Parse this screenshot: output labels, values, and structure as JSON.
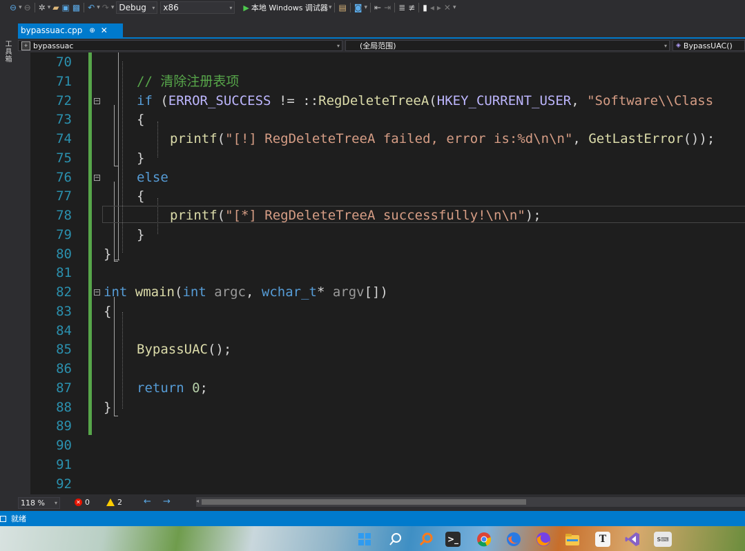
{
  "toolbar": {
    "config": "Debug",
    "platform": "x86",
    "debugger": "本地 Windows 调试器"
  },
  "side_panel": {
    "label": "工具箱"
  },
  "tab": {
    "filename": "bypassuac.cpp",
    "pin": "⊕",
    "close": "✕"
  },
  "navbar": {
    "project": "bypassuac",
    "scope": "(全局范围)",
    "member": "BypassUAC()"
  },
  "editor": {
    "lines": [
      {
        "n": "70",
        "tokens": []
      },
      {
        "n": "71",
        "tokens": [
          {
            "c": "cm",
            "t": "// 清除注册表项"
          }
        ]
      },
      {
        "n": "72",
        "tokens": [
          {
            "c": "kw",
            "t": "if"
          },
          {
            "c": "pn",
            "t": " ("
          },
          {
            "c": "mac",
            "t": "ERROR_SUCCESS"
          },
          {
            "c": "pn",
            "t": " != ::"
          },
          {
            "c": "fn",
            "t": "RegDeleteTreeA"
          },
          {
            "c": "pn",
            "t": "("
          },
          {
            "c": "mac",
            "t": "HKEY_CURRENT_USER"
          },
          {
            "c": "pn",
            "t": ", "
          },
          {
            "c": "str",
            "t": "\"Software\\\\Class"
          }
        ]
      },
      {
        "n": "73",
        "tokens": [
          {
            "c": "pn",
            "t": "{"
          }
        ]
      },
      {
        "n": "74",
        "tokens": [
          {
            "c": "fn",
            "t": "printf"
          },
          {
            "c": "pn",
            "t": "("
          },
          {
            "c": "str",
            "t": "\"[!] RegDeleteTreeA failed, error is:%d\\n\\n\""
          },
          {
            "c": "pn",
            "t": ", "
          },
          {
            "c": "fn",
            "t": "GetLastError"
          },
          {
            "c": "pn",
            "t": "());"
          }
        ]
      },
      {
        "n": "75",
        "tokens": [
          {
            "c": "pn",
            "t": "}"
          }
        ]
      },
      {
        "n": "76",
        "tokens": [
          {
            "c": "kw",
            "t": "else"
          }
        ]
      },
      {
        "n": "77",
        "tokens": [
          {
            "c": "pn",
            "t": "{"
          }
        ]
      },
      {
        "n": "78",
        "tokens": [
          {
            "c": "fn",
            "t": "printf"
          },
          {
            "c": "pn",
            "t": "("
          },
          {
            "c": "str",
            "t": "\"[*] RegDeleteTreeA successfully!\\n\\n\""
          },
          {
            "c": "pn",
            "t": ");"
          }
        ]
      },
      {
        "n": "79",
        "tokens": [
          {
            "c": "pn",
            "t": "}"
          }
        ]
      },
      {
        "n": "80",
        "tokens": [
          {
            "c": "pn",
            "t": "}"
          }
        ]
      },
      {
        "n": "81",
        "tokens": []
      },
      {
        "n": "82",
        "tokens": [
          {
            "c": "kw",
            "t": "int"
          },
          {
            "c": "pn",
            "t": " "
          },
          {
            "c": "fn",
            "t": "wmain"
          },
          {
            "c": "pn",
            "t": "("
          },
          {
            "c": "kw",
            "t": "int"
          },
          {
            "c": "pn",
            "t": " "
          },
          {
            "c": "prm",
            "t": "argc"
          },
          {
            "c": "pn",
            "t": ", "
          },
          {
            "c": "kw",
            "t": "wchar_t"
          },
          {
            "c": "pn",
            "t": "* "
          },
          {
            "c": "prm",
            "t": "argv"
          },
          {
            "c": "pn",
            "t": "[])"
          }
        ]
      },
      {
        "n": "83",
        "tokens": [
          {
            "c": "pn",
            "t": "{"
          }
        ]
      },
      {
        "n": "84",
        "tokens": []
      },
      {
        "n": "85",
        "tokens": [
          {
            "c": "fn",
            "t": "BypassUAC"
          },
          {
            "c": "pn",
            "t": "();"
          }
        ]
      },
      {
        "n": "86",
        "tokens": []
      },
      {
        "n": "87",
        "tokens": [
          {
            "c": "kw",
            "t": "return"
          },
          {
            "c": "pn",
            "t": " "
          },
          {
            "c": "num",
            "t": "0"
          },
          {
            "c": "pn",
            "t": ";"
          }
        ]
      },
      {
        "n": "88",
        "tokens": [
          {
            "c": "pn",
            "t": "}"
          }
        ]
      },
      {
        "n": "89",
        "tokens": []
      },
      {
        "n": "90",
        "tokens": []
      },
      {
        "n": "91",
        "tokens": []
      },
      {
        "n": "92",
        "tokens": []
      }
    ],
    "fold_marks": [
      "72",
      "76",
      "82"
    ],
    "current_line": "78"
  },
  "status": {
    "zoom": "118 %",
    "errors": "0",
    "warnings": "2",
    "ready": "就绪"
  },
  "taskbar": {
    "icons": [
      "windows-start-icon",
      "search-icon",
      "magnifier-app-icon",
      "terminal-icon",
      "chrome-icon",
      "firefox-dev-icon",
      "firefox-icon",
      "file-explorer-icon",
      "typora-icon",
      "visual-studio-icon",
      "keyboard-icon"
    ],
    "typora_letter": "T"
  },
  "colors": {
    "accent": "#007acc",
    "background": "#1e1e1e",
    "line_number": "#2b91af",
    "keyword": "#569cd6",
    "comment": "#57a64a",
    "string": "#d69d85",
    "function": "#dcdcaa",
    "macro": "#beb7ff"
  }
}
